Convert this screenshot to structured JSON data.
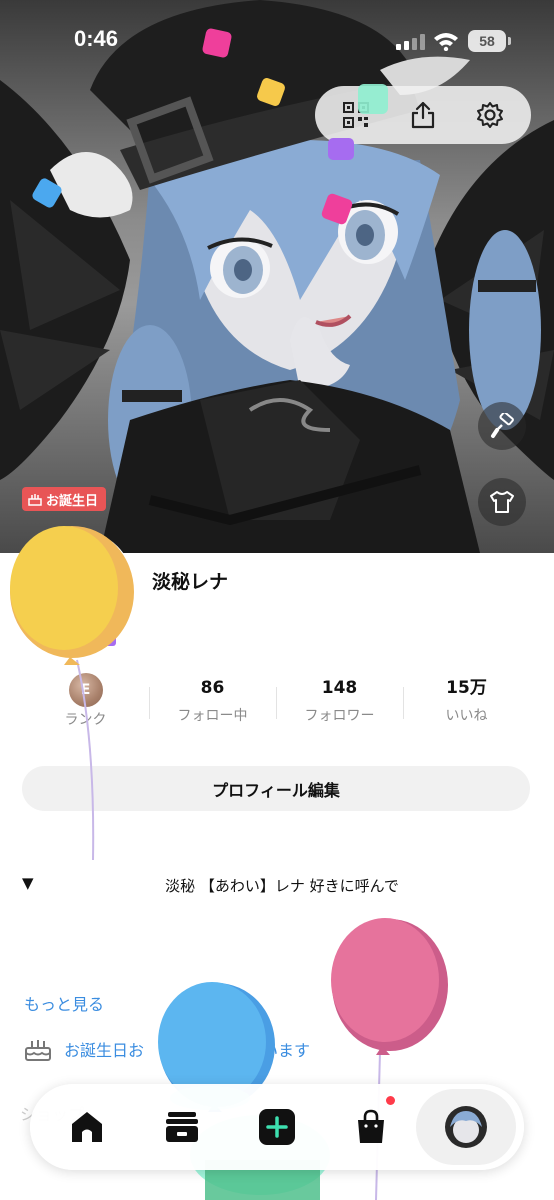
{
  "status_bar": {
    "time": "0:46",
    "battery": "58"
  },
  "hero": {
    "birthday_badge": "お誕生日",
    "top_actions": [
      "qr-code-icon",
      "share-icon",
      "gear-icon"
    ],
    "side_buttons": [
      "paint-roller-icon",
      "tshirt-icon"
    ]
  },
  "profile": {
    "display_name": "淡秘レナ",
    "rank": {
      "letter": "E",
      "label": "ランク"
    },
    "stats": [
      {
        "value": "86",
        "label": "フォロー中"
      },
      {
        "value": "148",
        "label": "フォロワー"
      },
      {
        "value": "15万",
        "label": "いいね"
      }
    ],
    "edit_button": "プロフィール編集",
    "bio_toggle": "▼",
    "bio": "淡秘 【あわい】レナ  好きに呼んで",
    "more_link": "もっと見る",
    "birthday_text": "お誕生日お",
    "birthday_text_end": "います",
    "shop_hint": "ショップ"
  },
  "bottom_nav": {
    "items": [
      "home-icon",
      "inbox-icon",
      "create-icon",
      "shop-icon",
      "profile-avatar"
    ],
    "shop_has_notification": true
  },
  "colors": {
    "accent_link": "#3b8de0",
    "badge_red": "#e85556",
    "create_button": "#1f9e74",
    "balloon_yellow": "#f5c84c",
    "balloon_blue": "#5ab0ee",
    "balloon_pink": "#e2709a"
  }
}
